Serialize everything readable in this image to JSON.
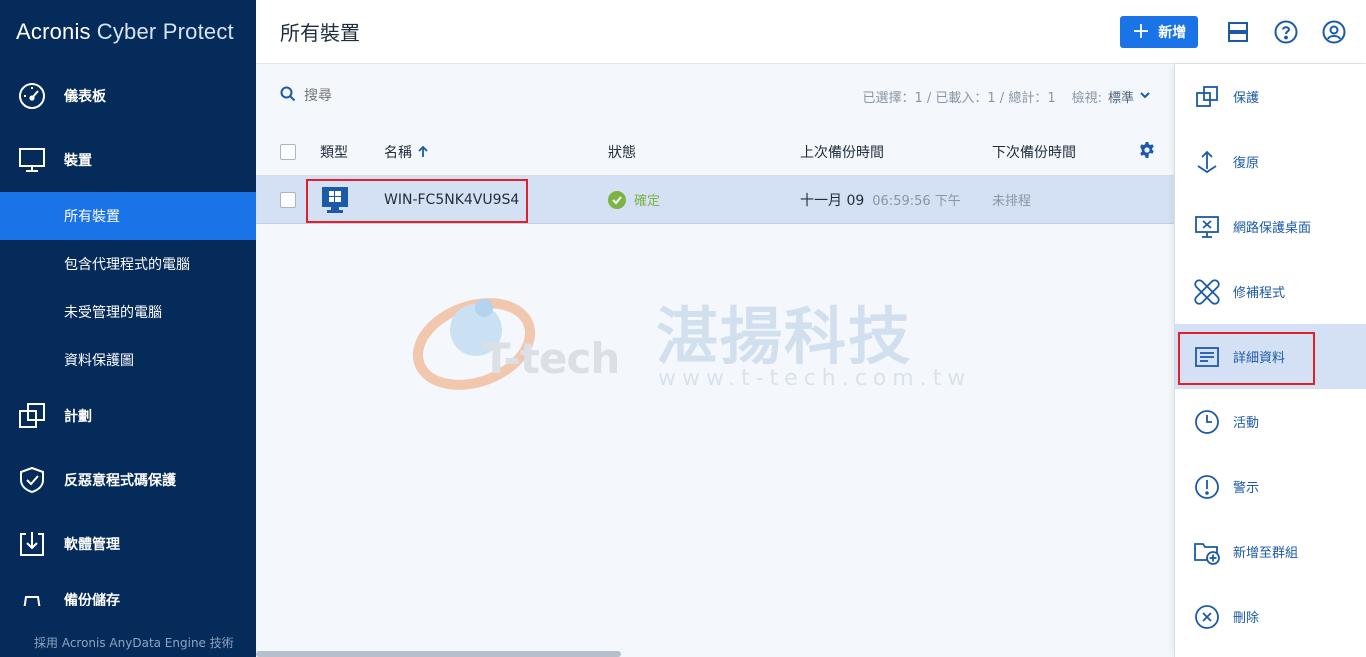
{
  "brand": {
    "part1": "Acronis",
    "part2": "Cyber Protect"
  },
  "sidebar": {
    "items": [
      {
        "label": "儀表板",
        "icon": "dashboard-icon"
      },
      {
        "label": "裝置",
        "icon": "monitor-icon"
      },
      {
        "label": "計劃",
        "icon": "plans-icon"
      },
      {
        "label": "反惡意程式碼保護",
        "icon": "shield-check-icon"
      },
      {
        "label": "軟體管理",
        "icon": "software-download-icon"
      },
      {
        "label": "備份儲存",
        "icon": "storage-icon"
      }
    ],
    "subitems": [
      {
        "label": "所有裝置",
        "active": true
      },
      {
        "label": "包含代理程式的電腦"
      },
      {
        "label": "未受管理的電腦"
      },
      {
        "label": "資料保護圖"
      }
    ],
    "footer": "採用 Acronis AnyData Engine 技術"
  },
  "header": {
    "title": "所有裝置",
    "new_button": "新增"
  },
  "toolbar": {
    "search_placeholder": "搜尋",
    "counts": "已選擇：1 / 已載入：1 / 總計：1",
    "view_label": "檢視:",
    "view_value": "標準"
  },
  "table": {
    "columns": {
      "type": "類型",
      "name": "名稱",
      "status": "狀態",
      "last_backup": "上次備份時間",
      "next_backup": "下次備份時間"
    },
    "rows": [
      {
        "name": "WIN-FC5NK4VU9S4",
        "status": "確定",
        "last_date": "十一月 09",
        "last_time": "06:59:56 下午",
        "next": "未排程"
      }
    ]
  },
  "watermark": {
    "cn": "湛揚科技",
    "url": "www.t-tech.com.tw",
    "logo": "T-tech"
  },
  "actions": [
    {
      "label": "保護",
      "icon": "protect-icon"
    },
    {
      "label": "復原",
      "icon": "recover-icon"
    },
    {
      "label": "網路保護桌面",
      "icon": "remote-desktop-icon"
    },
    {
      "label": "修補程式",
      "icon": "patch-icon"
    },
    {
      "label": "詳細資料",
      "icon": "details-icon",
      "selected": true
    },
    {
      "label": "活動",
      "icon": "clock-icon"
    },
    {
      "label": "警示",
      "icon": "alert-icon"
    },
    {
      "label": "新增至群組",
      "icon": "add-to-group-icon"
    },
    {
      "label": "刪除",
      "icon": "delete-icon"
    }
  ],
  "colors": {
    "sidebar_bg": "#042b5a",
    "accent": "#1b73e8",
    "ok": "#7cb342",
    "highlight": "#e0202a",
    "selected_row": "#d4e1f4"
  }
}
